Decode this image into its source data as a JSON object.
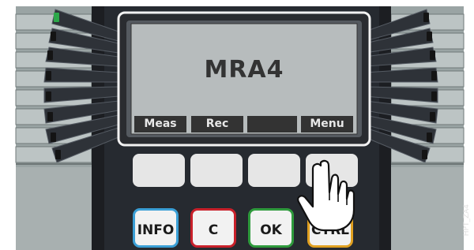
{
  "device": {
    "model_label": "MRA4",
    "drawing_code": "HPT_ZA4"
  },
  "softkeys": [
    "Meas",
    "Rec",
    "",
    "Menu"
  ],
  "front_keys": [
    {
      "label": "INFO",
      "color": "#3a9fd6"
    },
    {
      "label": "C",
      "color": "#c8202a"
    },
    {
      "label": "OK",
      "color": "#2e9a3c"
    },
    {
      "label": "CTRL",
      "color": "#e0a020"
    }
  ],
  "pointer_icon": "hand-pointer-icon",
  "led_color": "#2ca84a"
}
